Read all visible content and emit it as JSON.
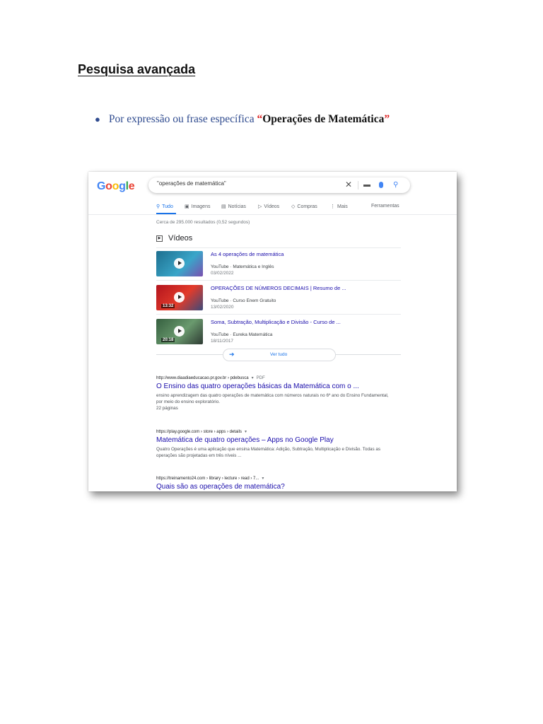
{
  "document": {
    "heading": "Pesquisa avançada",
    "bullet": {
      "text": "Por expressão ou frase específica ",
      "quote_open": "“",
      "quote": "Operações de Matemática",
      "quote_close": "”"
    }
  },
  "google": {
    "logo": [
      "G",
      "o",
      "o",
      "g",
      "l",
      "e"
    ],
    "logo_colors": [
      "#4285F4",
      "#EA4335",
      "#FBBC05",
      "#4285F4",
      "#34A853",
      "#EA4335"
    ],
    "search_value": "\"operações de matemática\"",
    "tabs": [
      {
        "label": "Tudo",
        "icon": "search-icon"
      },
      {
        "label": "Imagens",
        "icon": "image-icon"
      },
      {
        "label": "Notícias",
        "icon": "news-icon"
      },
      {
        "label": "Vídeos",
        "icon": "video-icon"
      },
      {
        "label": "Compras",
        "icon": "tag-icon"
      },
      {
        "label": "Mais",
        "icon": "more-vert-icon"
      }
    ],
    "tools": "Ferramentas",
    "stats": "Cerca de 295.000 resultados (0,52 segundos)",
    "videos_heading": "Vídeos",
    "videos": [
      {
        "title": "As 4 operações de matemática",
        "meta": "YouTube · Matemática e Inglês",
        "date": "03/02/2022",
        "thumb_color": "#2a8fb0",
        "duration": ""
      },
      {
        "title": "OPERAÇÕES DE NÚMEROS DECIMAIS | Resumo de ...",
        "meta": "YouTube · Curso Enem Gratuito",
        "date": "13/02/2020",
        "thumb_color": "#c8232c",
        "duration": "13:32"
      },
      {
        "title": "Soma, Subtração, Multiplicação e Divisão - Curso de ...",
        "meta": "YouTube · Eureka Matemática",
        "date": "18/11/2017",
        "thumb_color": "#3f7a4a",
        "duration": "20:18"
      }
    ],
    "view_all": "Ver tudo",
    "results": [
      {
        "url": "http://www.diaadiaeducacao.pr.gov.br › pdebusca",
        "badge": "PDF",
        "title": "O Ensino das quatro operações básicas da Matemática com o ...",
        "snippet": "ensino aprendizagem das quatro operações de matemática com números naturais no 6º ano do Ensino Fundamental, por meio do ensino exploratório.",
        "extra": "22 páginas"
      },
      {
        "url": "https://play.google.com › store › apps › details",
        "title": "Matemática de quatro operações – Apps no Google Play",
        "snippet": "Quatro Operações é uma aplicação que ensina Matemática: Adição, Subtração, Multiplicação e Divisão. Todas as operações são projetadas em três níveis ..."
      },
      {
        "url": "https://treinamento24.com › library › lecture › read › 7...",
        "title": "Quais são as operações de matemática?"
      }
    ]
  }
}
